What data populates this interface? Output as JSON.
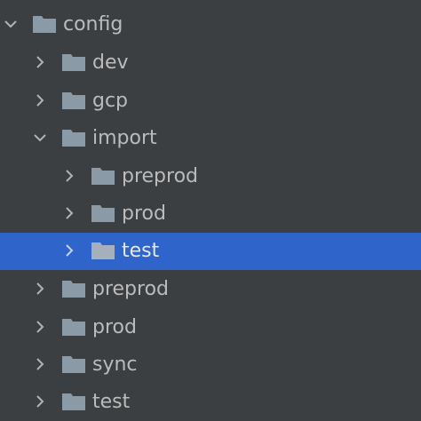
{
  "colors": {
    "background": "#3c3f41",
    "selection": "#2f65ca",
    "text": "#bbbbbb",
    "folder_icon": "#8a9aa6",
    "arrow": "#aeb3b7"
  },
  "tree": {
    "items": [
      {
        "label": "config",
        "expanded": true,
        "icon": "folder-icon"
      },
      {
        "label": "dev",
        "expanded": false,
        "icon": "folder-icon"
      },
      {
        "label": "gcp",
        "expanded": false,
        "icon": "folder-icon"
      },
      {
        "label": "import",
        "expanded": true,
        "icon": "folder-icon"
      },
      {
        "label": "preprod",
        "expanded": false,
        "icon": "folder-icon"
      },
      {
        "label": "prod",
        "expanded": false,
        "icon": "folder-icon"
      },
      {
        "label": "test",
        "expanded": false,
        "selected": true,
        "icon": "folder-icon"
      },
      {
        "label": "preprod",
        "expanded": false,
        "icon": "folder-icon"
      },
      {
        "label": "prod",
        "expanded": false,
        "icon": "folder-icon"
      },
      {
        "label": "sync",
        "expanded": false,
        "icon": "folder-icon"
      },
      {
        "label": "test",
        "expanded": false,
        "icon": "folder-icon"
      }
    ]
  }
}
